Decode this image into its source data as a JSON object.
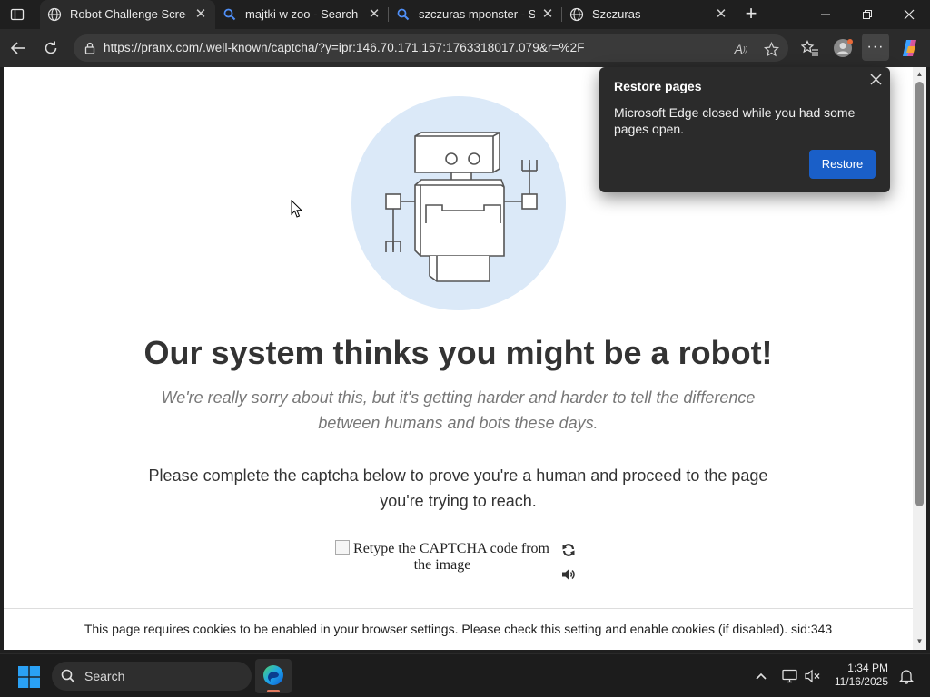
{
  "browser": {
    "tabs": [
      {
        "title": "Robot Challenge Screen",
        "icon": "globe-icon",
        "active": true
      },
      {
        "title": "majtki w zoo - Search",
        "icon": "search-icon",
        "active": false
      },
      {
        "title": "szczuras mponster - Sear",
        "icon": "search-icon",
        "active": false
      },
      {
        "title": "Szczuras",
        "icon": "globe-icon",
        "active": false
      }
    ],
    "url": "https://pranx.com/.well-known/captcha/?y=ipr:146.70.171.157:1763318017.079&r=%2F",
    "read_aloud_label": "A",
    "more_label": "···"
  },
  "page": {
    "headline": "Our system thinks you might be a robot!",
    "subhead": "We're really sorry about this, but it's getting harder and harder to tell the difference between humans and bots these days.",
    "instructions": "Please complete the captcha below to prove you're a human and proceed to the page you're trying to reach.",
    "captcha_alt": "Retype the CAPTCHA code from the image",
    "cookie_notice": "This page requires cookies to be enabled in your browser settings. Please check this setting and enable cookies (if disabled). sid:343"
  },
  "popup": {
    "title": "Restore pages",
    "body": "Microsoft Edge closed while you had some pages open.",
    "button": "Restore"
  },
  "taskbar": {
    "search_label": "Search",
    "time": "1:34 PM",
    "date": "11/16/2025"
  },
  "colors": {
    "accent": "#1a5fc8",
    "robot_circle": "#dbe9f8",
    "headline": "#333333",
    "subhead": "#777777"
  }
}
